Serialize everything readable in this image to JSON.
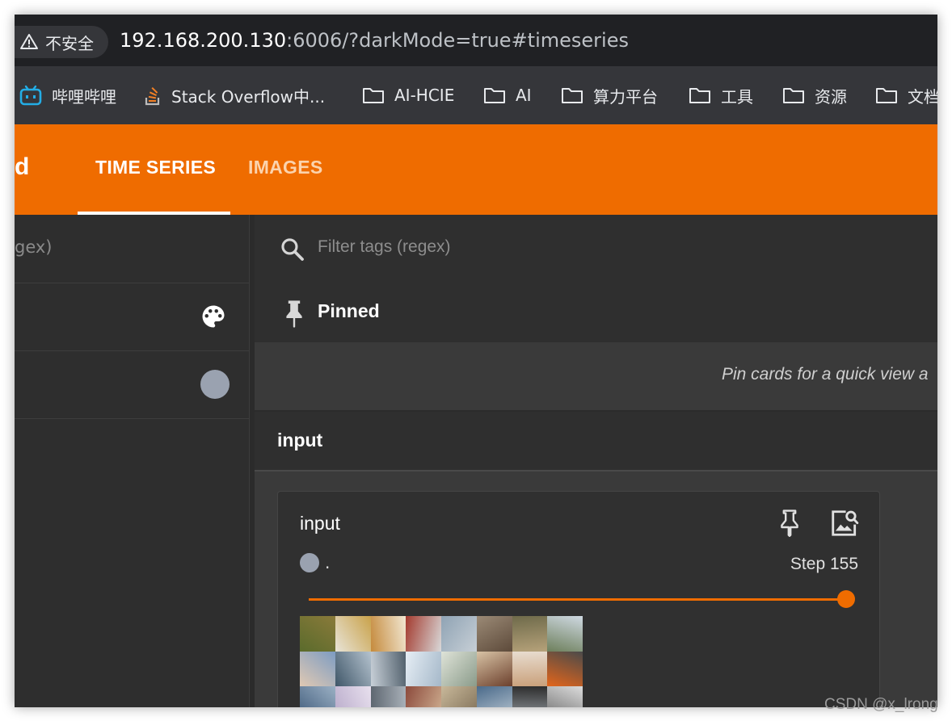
{
  "browser": {
    "security_label": "不安全",
    "url_host": "192.168.200.130",
    "url_rest": ":6006/?darkMode=true#timeseries"
  },
  "bookmarks": [
    {
      "label": "哔哩哔哩",
      "icon": "bilibili-icon"
    },
    {
      "label": "Stack Overflow中...",
      "icon": "stackoverflow-icon"
    },
    {
      "label": "AI-HCIE",
      "icon": "folder-icon"
    },
    {
      "label": "AI",
      "icon": "folder-icon"
    },
    {
      "label": "算力平台",
      "icon": "folder-icon"
    },
    {
      "label": "工具",
      "icon": "folder-icon"
    },
    {
      "label": "资源",
      "icon": "folder-icon"
    },
    {
      "label": "文档",
      "icon": "folder-icon"
    }
  ],
  "header": {
    "brand_fragment": "d",
    "tabs": [
      {
        "label": "TIME SERIES",
        "active": true
      },
      {
        "label": "IMAGES",
        "active": false
      }
    ],
    "color": "#ef6c00"
  },
  "sidebar": {
    "filter_placeholder_fragment": "gex)",
    "run_color": "#9aa2b0"
  },
  "main": {
    "filter_placeholder": "Filter tags (regex)",
    "pinned_label": "Pinned",
    "pinned_empty_text": "Pin cards for a quick view a",
    "group_title": "input"
  },
  "card": {
    "title": "input",
    "run_label": ".",
    "step_label": "Step 155",
    "step_position": 1.0,
    "accent": "#ef6c00",
    "image_tiles": 24
  },
  "watermark": "CSDN @x_lrong"
}
